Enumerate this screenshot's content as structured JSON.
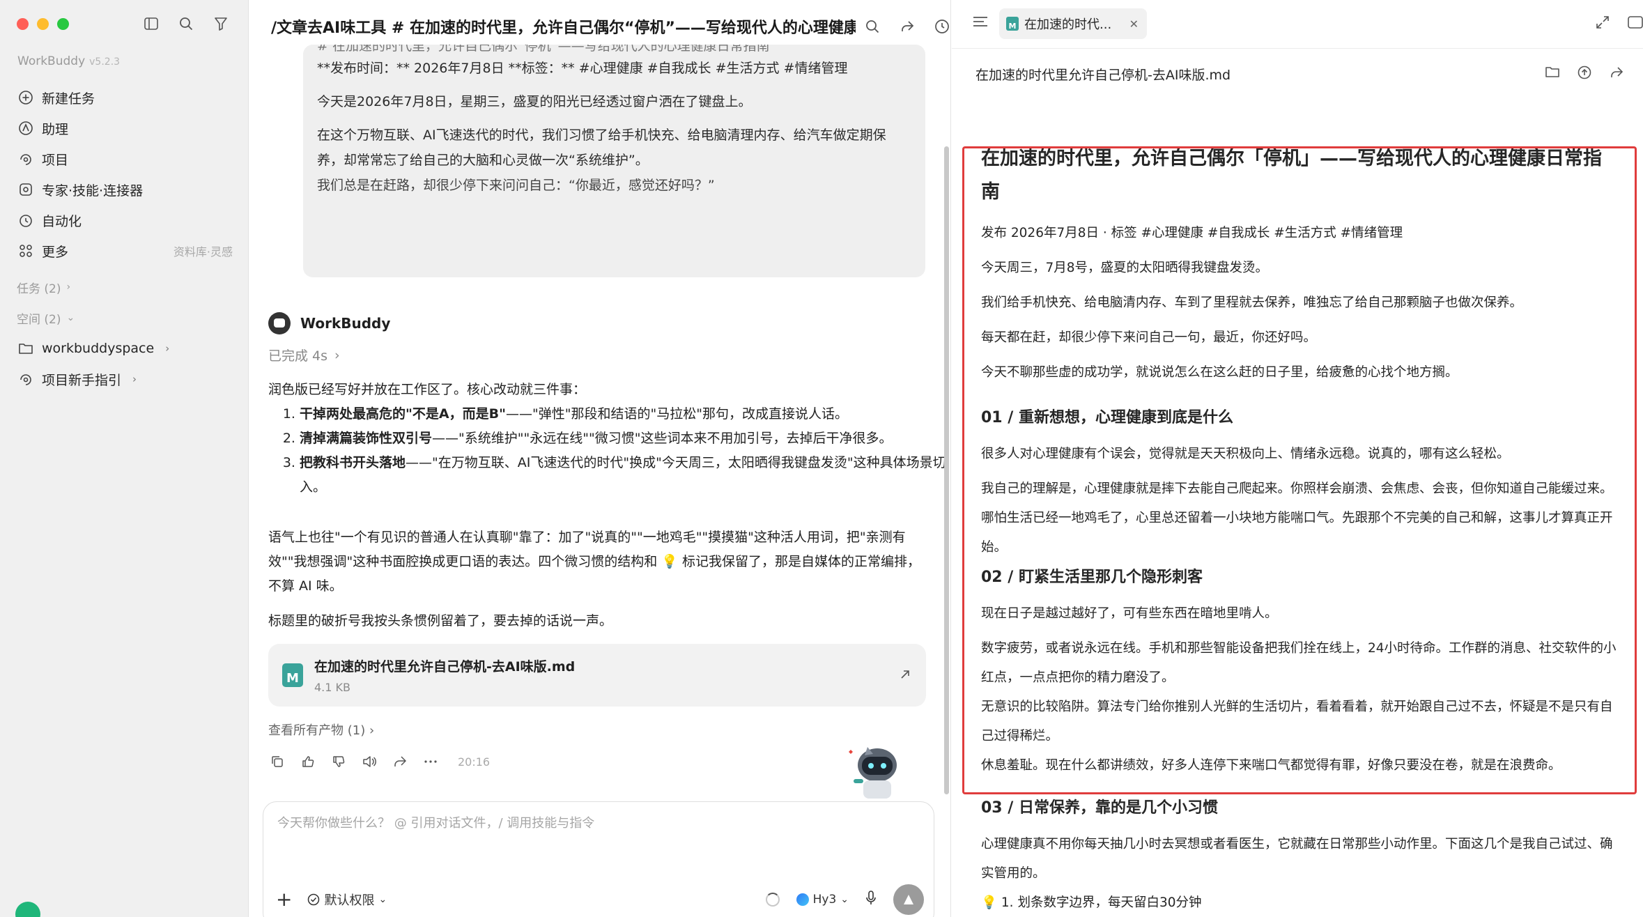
{
  "sidebar": {
    "app_name": "WorkBuddy",
    "version": "v5.2.3",
    "nav": [
      {
        "label": "新建任务",
        "icon": "plus-circle-icon"
      },
      {
        "label": "助理",
        "icon": "assistant-icon"
      },
      {
        "label": "项目",
        "icon": "project-icon"
      },
      {
        "label": "专家·技能·连接器",
        "icon": "experts-icon"
      },
      {
        "label": "自动化",
        "icon": "clock-icon"
      },
      {
        "label": "更多",
        "icon": "grid-icon",
        "extra": "资料库·灵感"
      }
    ],
    "tasks_header": "任务 (2)",
    "spaces_header": "空间 (2)",
    "spaces": [
      {
        "label": "workbuddyspace",
        "icon": "folder-icon"
      },
      {
        "label": "项目新手指引",
        "icon": "project-icon"
      }
    ]
  },
  "chat": {
    "title": "/文章去AI味工具 # 在加速的时代里，允许自己偶尔“停机”——写给现代人的心理健康",
    "quote": {
      "top_cut": "# 在加速的时代里，允许自己偶尔“停机”——写给现代人的心理健康日常指南",
      "p1": "**发布时间：** 2026年7月8日  **标签：** #心理健康 #自我成长 #生活方式 #情绪管理",
      "p2": "今天是2026年7月8日，星期三，盛夏的阳光已经透过窗户洒在了键盘上。",
      "p3": "在这个万物互联、AI飞速迭代的时代，我们习惯了给手机快充、给电脑清理内存、给汽车做定期保养，却常常忘了给自己的大脑和心灵做一次“系统维护”。",
      "p4": "我们总是在赶路，却很少停下来问问自己：“你最近，感觉还好吗？”"
    },
    "bot_name": "WorkBuddy",
    "status": "已完成 4s",
    "intro": "润色版已经写好并放在工作区了。核心改动就三件事：",
    "changes": [
      {
        "bold": "干掉两处最高危的\"不是A，而是B\"",
        "rest": "——\"弹性\"那段和结语的\"马拉松\"那句，改成直接说人话。"
      },
      {
        "bold": "清掉满篇装饰性双引号",
        "rest": "——\"系统维护\"\"永远在线\"\"微习惯\"这些词本来不用加引号，去掉后干净很多。"
      },
      {
        "bold": "把教科书开头落地",
        "rest": "——\"在万物互联、AI飞速迭代的时代\"换成\"今天周三，太阳晒得我键盘发烫\"这种具体场景切入。"
      }
    ],
    "para2": "语气上也往\"一个有见识的普通人在认真聊\"靠了：加了\"说真的\"\"一地鸡毛\"\"摸摸猫\"这种活人用词，把\"亲测有效\"\"我想强调\"这种书面腔换成更口语的表达。四个微习惯的结构和 💡 标记我保留了，那是自媒体的正常编排，不算 AI 味。",
    "para3": "标题里的破折号我按头条惯例留着了，要去掉的话说一声。",
    "file": {
      "name": "在加速的时代里允许自己停机-去AI味版.md",
      "size": "4.1 KB",
      "icon_text": "M"
    },
    "artifacts": "查看所有产物 (1)",
    "time": "20:16",
    "input_placeholder": "今天帮你做些什么？ @ 引用对话文件，/ 调用技能与指令",
    "permission": "默认权限",
    "model": "Hy3"
  },
  "preview": {
    "tab_label": "在加速的时代...",
    "file_path": "在加速的时代里允许自己停机-去AI味版.md",
    "doc": {
      "title": "在加速的时代里，允许自己偶尔「停机」——写给现代人的心理健康日常指南",
      "meta": "发布 2026年7月8日 · 标签 #心理健康 #自我成长 #生活方式 #情绪管理",
      "p1": "今天周三，7月8号，盛夏的太阳晒得我键盘发烫。",
      "p2": "我们给手机快充、给电脑清内存、车到了里程就去保养，唯独忘了给自己那颗脑子也做次保养。",
      "p3": "每天都在赶，却很少停下来问自己一句，最近，你还好吗。",
      "p4": "今天不聊那些虚的成功学，就说说怎么在这么赶的日子里，给疲惫的心找个地方搁。",
      "h01": "01 / 重新想想，心理健康到底是什么",
      "p5": "很多人对心理健康有个误会，觉得就是天天积极向上、情绪永远稳。说真的，哪有这么轻松。",
      "p6": "我自己的理解是，心理健康就是摔下去能自己爬起来。你照样会崩溃、会焦虑、会丧，但你知道自己能缓过来。哪怕生活已经一地鸡毛了，心里总还留着一小块地方能喘口气。先跟那个不完美的自己和解，这事儿才算真正开始。",
      "h02": "02 / 盯紧生活里那几个隐形刺客",
      "p7": "现在日子是越过越好了，可有些东西在暗地里啃人。",
      "p8": "数字疲劳，或者说永远在线。手机和那些智能设备把我们拴在线上，24小时待命。工作群的消息、社交软件的小红点，一点点把你的精力磨没了。",
      "p9": "无意识的比较陷阱。算法专门给你推别人光鲜的生活切片，看着看着，就开始跟自己过不去，怀疑是不是只有自己过得稀烂。",
      "p10": "休息羞耻。现在什么都讲绩效，好多人连停下来喘口气都觉得有罪，好像只要没在卷，就是在浪费命。",
      "h03": "03 / 日常保养，靠的是几个小习惯",
      "p11": "心理健康真不用你每天抽几小时去冥想或者看医生，它就藏在日常那些小动作里。下面这几个是我自己试过、确实管用的。",
      "p12": "💡 1. 划条数字边界，每天留白30分钟"
    }
  },
  "colors": {
    "highlight": "#e03c3c",
    "md_icon": "#3aa39a",
    "sidebar_bg": "#f0f0f0"
  }
}
